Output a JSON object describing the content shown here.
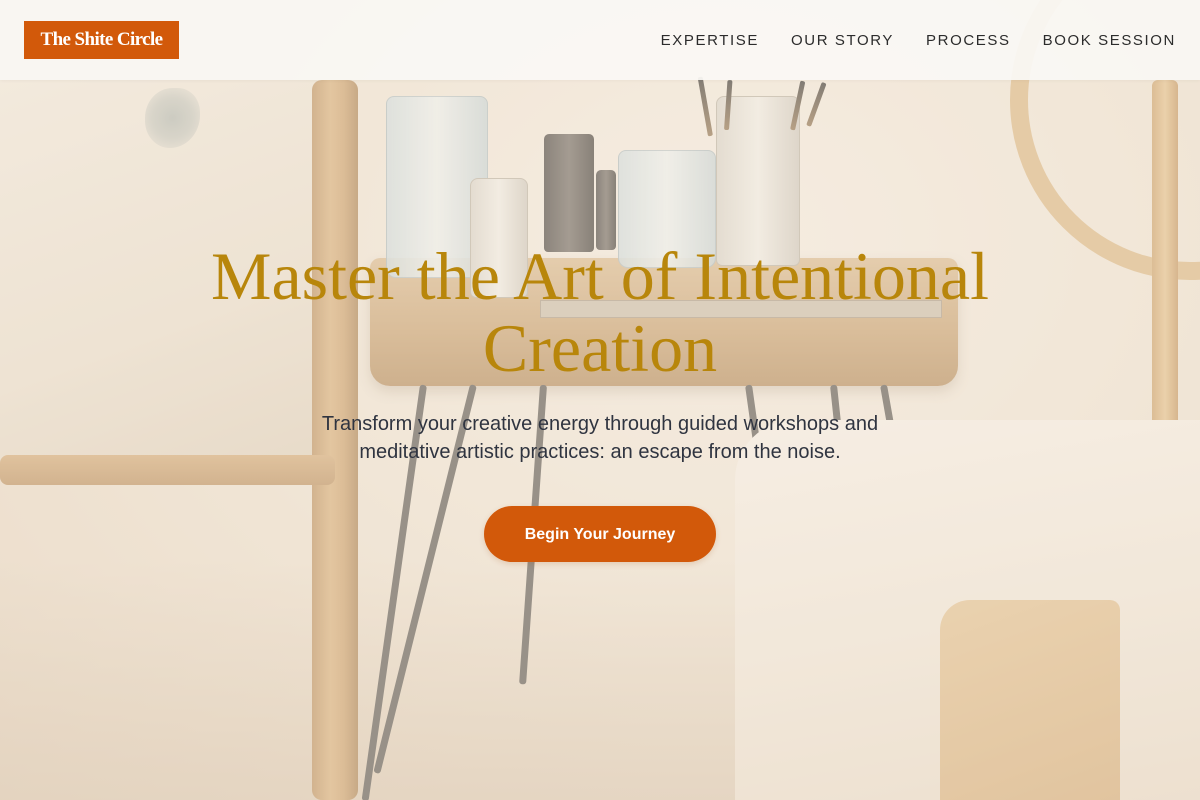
{
  "header": {
    "logo_text": "The Shite Circle",
    "nav": [
      {
        "label": "EXPERTISE"
      },
      {
        "label": "OUR STORY"
      },
      {
        "label": "PROCESS"
      },
      {
        "label": "BOOK SESSION"
      }
    ]
  },
  "hero": {
    "title": "Master the Art of Intentional Creation",
    "subtitle": "Transform your creative energy through guided workshops and meditative artistic practices: an escape from the noise.",
    "cta_label": "Begin Your Journey",
    "background_image": "artist-studio-side-table-photo"
  },
  "colors": {
    "brand_orange": "#d2590a",
    "title_gold": "#b8860b",
    "body_text": "#2f3440",
    "header_bg": "#faf7f4"
  }
}
